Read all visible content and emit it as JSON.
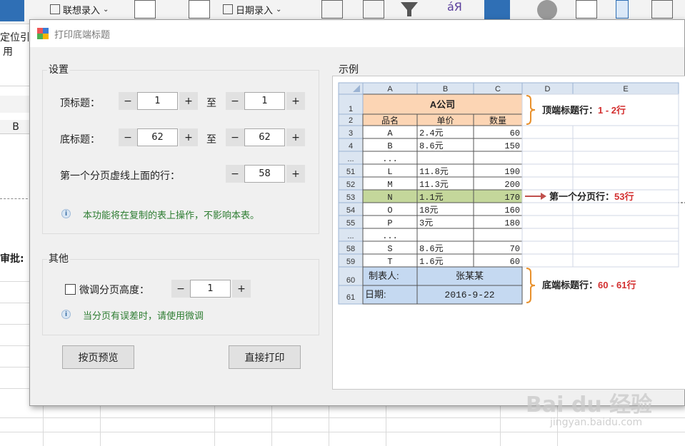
{
  "ribbon": {
    "lianxiang": "联想录入",
    "riqi": "日期录入",
    "dingwei": "定位引",
    "yong": "用"
  },
  "bg": {
    "col_b": "B",
    "shenpi": "审批:"
  },
  "dialog": {
    "title": "打印底端标题",
    "settings": {
      "label": "设置",
      "top_title_label": "顶标题：",
      "top_from": "1",
      "top_to": "1",
      "to_word": "至",
      "bottom_title_label": "底标题：",
      "bottom_from": "62",
      "bottom_to": "62",
      "first_break_label": "第一个分页虚线上面的行：",
      "first_break_value": "58",
      "info": "本功能将在复制的表上操作，不影响本表。"
    },
    "other": {
      "label": "其他",
      "fine_tune_label": "微调分页高度：",
      "fine_tune_value": "1",
      "info": "当分页有误差时，请使用微调"
    },
    "buttons": {
      "preview": "按页预览",
      "print": "直接打印"
    },
    "minus": "−",
    "plus": "+"
  },
  "example": {
    "label": "示例",
    "col_headers": [
      "A",
      "B",
      "C",
      "D",
      "E"
    ],
    "company": "A公司",
    "headers": [
      "品名",
      "单价",
      "数量"
    ],
    "rows": [
      {
        "num": "3",
        "a": "A",
        "b": "2.4元",
        "c": "60"
      },
      {
        "num": "4",
        "a": "B",
        "b": "8.6元",
        "c": "150"
      },
      {
        "num": "...",
        "a": "...",
        "b": "",
        "c": ""
      },
      {
        "num": "51",
        "a": "L",
        "b": "11.8元",
        "c": "190"
      },
      {
        "num": "52",
        "a": "M",
        "b": "11.3元",
        "c": "200"
      },
      {
        "num": "53",
        "a": "N",
        "b": "1.1元",
        "c": "170"
      },
      {
        "num": "54",
        "a": "O",
        "b": "18元",
        "c": "160"
      },
      {
        "num": "55",
        "a": "P",
        "b": "3元",
        "c": "180"
      },
      {
        "num": "...",
        "a": "...",
        "b": "",
        "c": ""
      },
      {
        "num": "58",
        "a": "S",
        "b": "8.6元",
        "c": "70"
      },
      {
        "num": "59",
        "a": "T",
        "b": "1.6元",
        "c": "60"
      }
    ],
    "row1": "1",
    "row2": "2",
    "row60": "60",
    "row61": "61",
    "maker_label": "制表人:",
    "maker_value": "张某某",
    "date_label": "日期:",
    "date_value": "2016-9-22",
    "ann_top": "顶端标题行：",
    "ann_top_red": "1 - 2行",
    "ann_break": "第一个分页行：",
    "ann_break_red": "53行",
    "ann_bottom": "底端标题行：",
    "ann_bottom_red": "60 - 61行"
  },
  "watermark": {
    "brand": "Bai du 经验",
    "url": "jingyan.baidu.com"
  },
  "colors": {
    "header_orange": "#fcd5b4",
    "highlight_green": "#c4d79b",
    "footer_blue": "#c5d9f1",
    "annotation_red": "#d32f2f",
    "bracket_orange": "#e8912d"
  }
}
